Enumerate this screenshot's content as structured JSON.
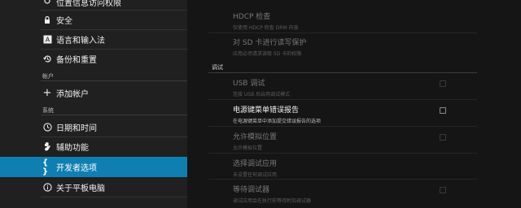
{
  "sidebar": {
    "items_top": [
      {
        "label": "位置信息访问权限",
        "icon": "location-icon"
      },
      {
        "label": "安全",
        "icon": "lock-icon"
      },
      {
        "label": "语言和输入法",
        "icon": "keyboard-a-icon"
      },
      {
        "label": "备份和重置",
        "icon": "backup-restore-icon"
      }
    ],
    "accounts_header": "帐户",
    "add_account": {
      "label": "添加帐户",
      "icon": "plus-icon"
    },
    "system_header": "系统",
    "system_items": [
      {
        "label": "日期和时间",
        "icon": "clock-icon"
      },
      {
        "label": "辅助功能",
        "icon": "hand-icon"
      },
      {
        "label": "开发者选项",
        "icon": "braces-icon",
        "active": true
      },
      {
        "label": "关于平板电脑",
        "icon": "info-icon"
      }
    ]
  },
  "content": {
    "prefs_top": [
      {
        "title": "HDCP 检查",
        "summary": "仅使用 HDCP 检查 DRM 内容",
        "enabled": false
      },
      {
        "title": "对 SD 卡进行读写保护",
        "summary": "应用必须请求读取 SD 卡的权限",
        "enabled": false
      }
    ],
    "debug_header": "调试",
    "prefs_debug": [
      {
        "title": "USB 调试",
        "summary": "连接 USB 后启用调试模式",
        "enabled": false,
        "checkbox": true
      },
      {
        "title": "电源键菜单错误报告",
        "summary": "在电源键菜单中添加提交错误报告的选项",
        "enabled": true,
        "checkbox": true
      },
      {
        "title": "允许模拟位置",
        "summary": "允许模拟位置",
        "enabled": false,
        "checkbox": true
      },
      {
        "title": "选择调试应用",
        "summary": "未设置任何调试应用",
        "enabled": false,
        "checkbox": false
      },
      {
        "title": "等待调试器",
        "summary": "调试应用会在执行前等待附加调试器",
        "enabled": false,
        "checkbox": true
      }
    ]
  },
  "colors": {
    "accent": "#0f7fb2",
    "sidebar_bg": "#202020",
    "content_bg": "#151515"
  }
}
